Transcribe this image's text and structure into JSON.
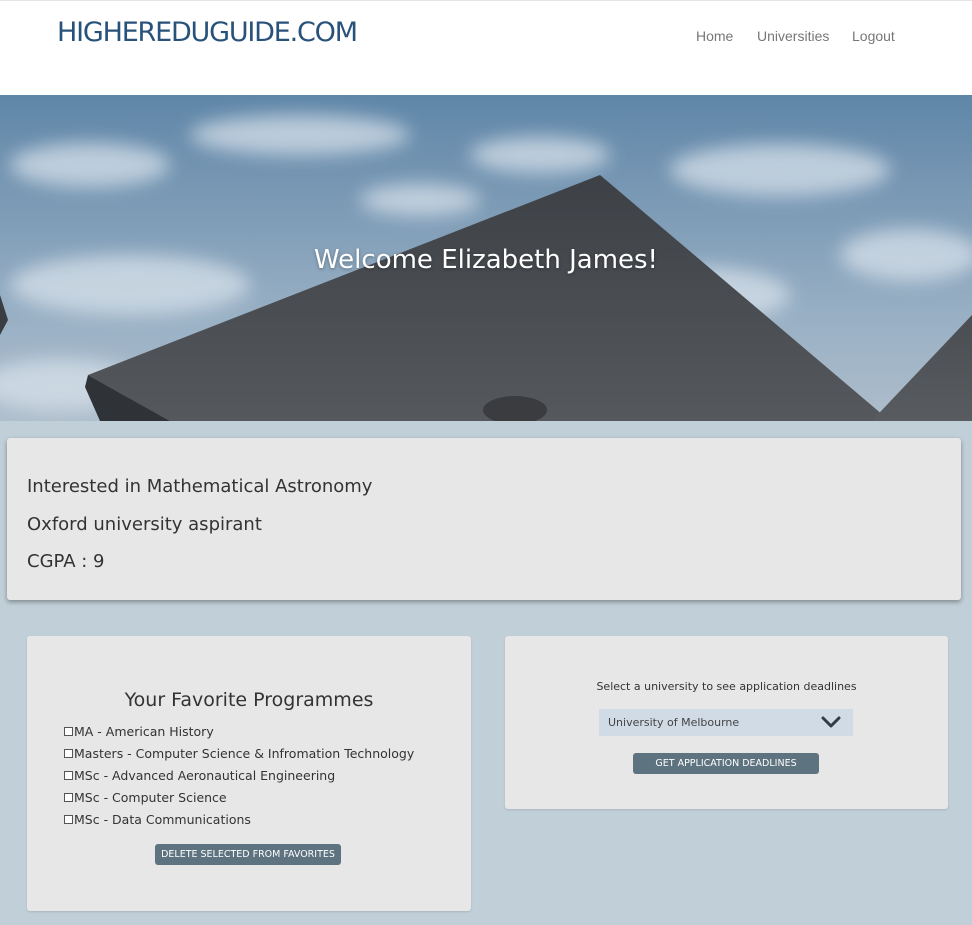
{
  "header": {
    "logo": "HIGHEREDUGUIDE.COM",
    "nav": [
      {
        "label": "Home"
      },
      {
        "label": "Universities"
      },
      {
        "label": "Logout"
      }
    ]
  },
  "hero": {
    "welcome": "Welcome Elizabeth James!"
  },
  "profile": {
    "interest": "Interested in Mathematical Astronomy",
    "aspiration": "Oxford university aspirant",
    "cgpa": "CGPA : 9"
  },
  "favorites": {
    "title": "Your Favorite Programmes",
    "items": [
      {
        "label": "MA - American History",
        "checked": false
      },
      {
        "label": "Masters - Computer Science & Infromation Technology",
        "checked": false
      },
      {
        "label": "MSc - Advanced Aeronautical Engineering",
        "checked": false
      },
      {
        "label": "MSc - Computer Science",
        "checked": false
      },
      {
        "label": "MSc - Data Communications",
        "checked": false
      }
    ],
    "delete_label": "DELETE SELECTED FROM FAVORITES"
  },
  "deadlines": {
    "prompt": "Select a university to see application deadlines",
    "selected": "University of Melbourne",
    "button_label": "GET APPLICATION DEADLINES"
  },
  "colors": {
    "logo": "#28527a",
    "page_background": "#c1cfd8",
    "card": "#e7e7e7",
    "button": "#5e7380",
    "select": "#d1dbe6"
  }
}
